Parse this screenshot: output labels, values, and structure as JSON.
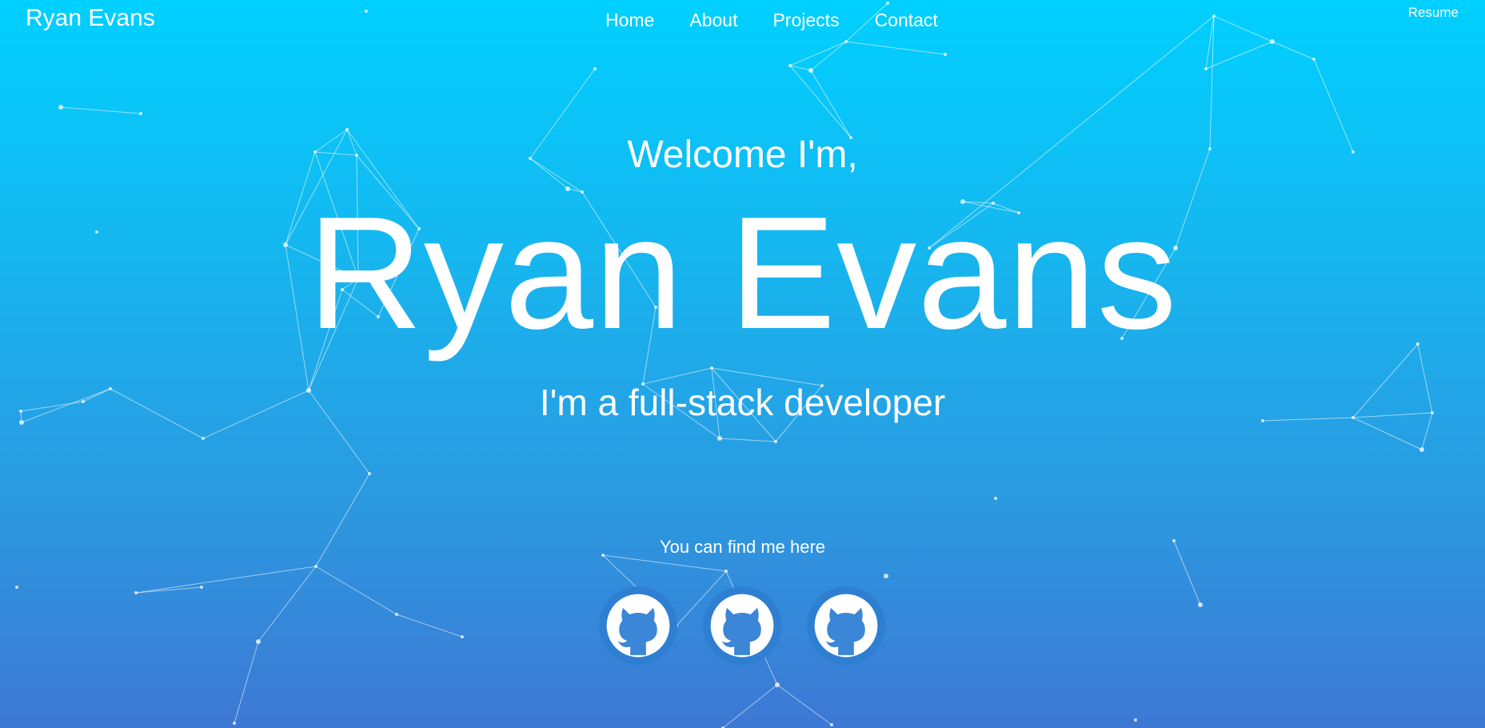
{
  "header": {
    "brand": "Ryan Evans",
    "nav": [
      "Home",
      "About",
      "Projects",
      "Contact"
    ],
    "resume": "Resume"
  },
  "hero": {
    "welcome": "Welcome I'm,",
    "name": "Ryan Evans",
    "tagline": "I'm a full-stack developer"
  },
  "social": {
    "label": "You can find me here",
    "links": [
      {
        "icon": "github-icon"
      },
      {
        "icon": "github-icon"
      },
      {
        "icon": "github-icon"
      }
    ]
  },
  "colors": {
    "gradient_top": "#00d0ff",
    "gradient_bottom": "#3d78d4",
    "icon_ring": "#2e7fd2",
    "icon_glyph": "#3b86d6"
  }
}
